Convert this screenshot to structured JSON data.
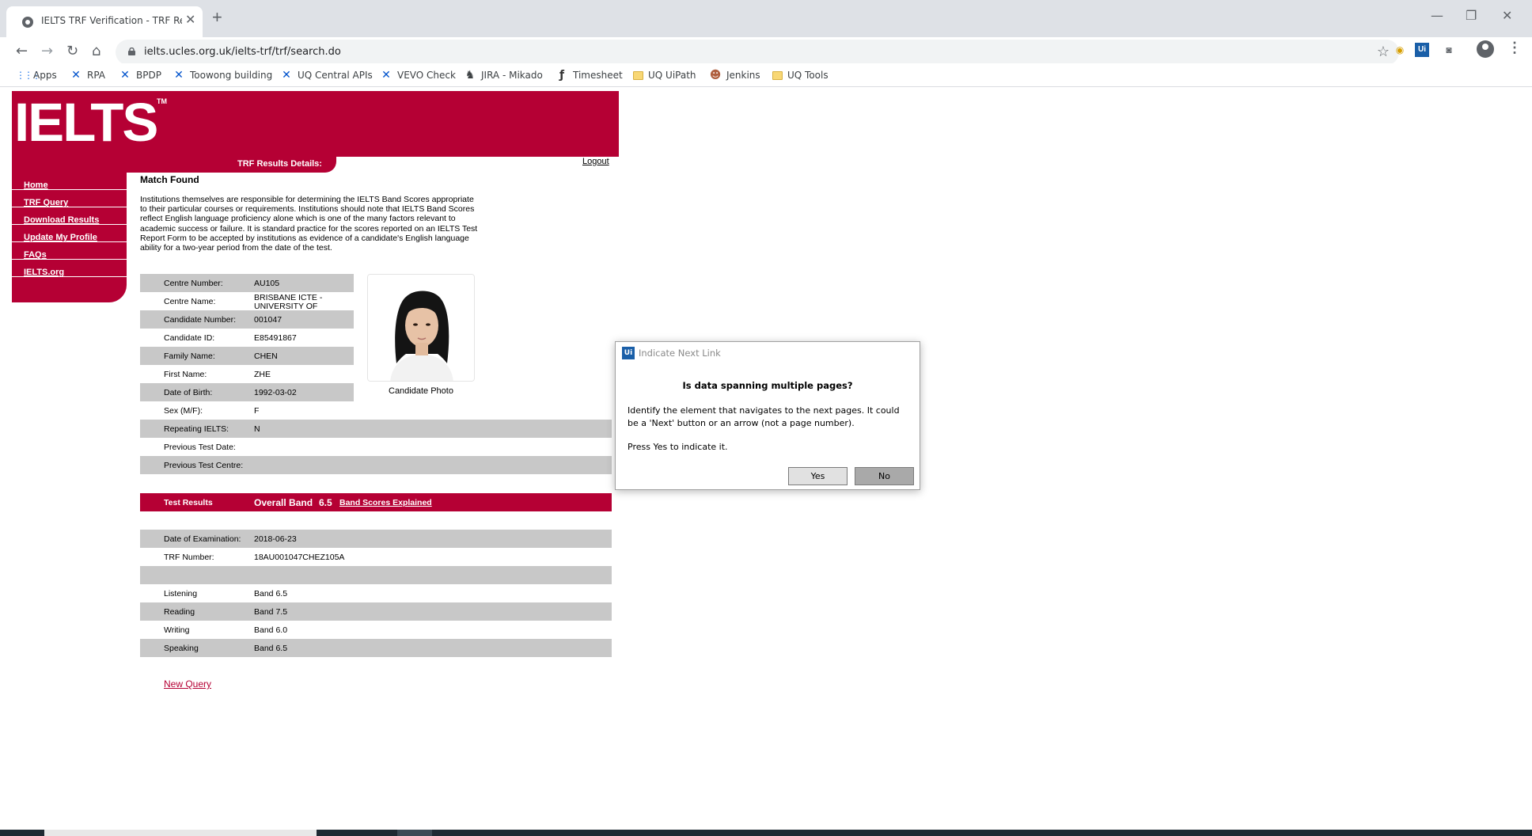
{
  "browser": {
    "tab_title": "IELTS TRF Verification - TRF Resul",
    "tab_close": "✕",
    "new_tab": "+",
    "window_controls": {
      "minimize": "—",
      "restore": "❐",
      "close": "✕"
    },
    "url": "ielts.ucles.org.uk/ielts-trf/trf/search.do",
    "bookmarks": [
      {
        "label": "Apps",
        "icon": "apps-grid-icon"
      },
      {
        "label": "RPA",
        "icon": "jira-icon"
      },
      {
        "label": "BPDP",
        "icon": "jira-icon"
      },
      {
        "label": "Toowong building",
        "icon": "jira-icon"
      },
      {
        "label": "UQ Central APIs",
        "icon": "jira-icon"
      },
      {
        "label": "VEVO Check",
        "icon": "jira-icon"
      },
      {
        "label": "JIRA - Mikado",
        "icon": "person-icon"
      },
      {
        "label": "Timesheet",
        "icon": "timesheet-icon"
      },
      {
        "label": "UQ UiPath",
        "icon": "folder-icon"
      },
      {
        "label": "Jenkins",
        "icon": "jenkins-icon"
      },
      {
        "label": "UQ Tools",
        "icon": "folder-icon"
      }
    ]
  },
  "ielts": {
    "logo": "IELTS",
    "logo_tm": "TM",
    "results_title": "TRF Results Details:",
    "logout": "Logout",
    "sidebar": [
      "Home",
      "TRF Query",
      "Download Results",
      "Update My Profile",
      "FAQs",
      "IELTS.org"
    ],
    "match_found": "Match Found",
    "disclaimer": "Institutions themselves are responsible for determining the IELTS Band Scores appropriate to their particular courses or requirements. Institutions should note that IELTS Band Scores reflect English language proficiency alone which is one of the many factors relevant to academic success or failure. It is standard practice for the scores reported on an IELTS Test Report Form to be accepted by institutions as evidence of a candidate's English language ability for a two-year period from the date of the test.",
    "candidate_rows": [
      {
        "label": "Centre Number:",
        "value": "AU105"
      },
      {
        "label": "Centre Name:",
        "value": "BRISBANE ICTE - UNIVERSITY OF"
      },
      {
        "label": "Candidate Number:",
        "value": "001047"
      },
      {
        "label": "Candidate ID:",
        "value": "E85491867"
      },
      {
        "label": "Family Name:",
        "value": "CHEN"
      },
      {
        "label": "First Name:",
        "value": "ZHE"
      },
      {
        "label": "Date of Birth:",
        "value": "1992-03-02"
      },
      {
        "label": "Sex (M/F):",
        "value": "F"
      },
      {
        "label": "Repeating IELTS:",
        "value": "N"
      },
      {
        "label": "Previous Test Date:",
        "value": ""
      },
      {
        "label": "Previous Test Centre:",
        "value": ""
      }
    ],
    "photo_caption": "Candidate Photo",
    "test_results": {
      "label": "Test Results",
      "overall_label": "Overall Band",
      "overall_value": "6.5",
      "band_link": "Band Scores Explained"
    },
    "exam_rows": [
      {
        "label": "Date of Examination:",
        "value": "2018-06-23"
      },
      {
        "label": "TRF Number:",
        "value": "18AU001047CHEZ105A"
      }
    ],
    "scores": [
      {
        "label": "Listening",
        "value": "Band  6.5"
      },
      {
        "label": "Reading",
        "value": "Band  7.5"
      },
      {
        "label": "Writing",
        "value": "Band  6.0"
      },
      {
        "label": "Speaking",
        "value": "Band  6.5"
      }
    ],
    "new_query": "New Query"
  },
  "dialog": {
    "logo": "Ui",
    "title": "Indicate Next Link",
    "question": "Is data spanning multiple pages?",
    "body": "Identify the element that navigates to the next pages. It could be a 'Next' button or an arrow (not a page number).",
    "press": "Press Yes to indicate it.",
    "yes": "Yes",
    "no": "No"
  },
  "colors": {
    "ielts_red": "#b50034",
    "row_shade": "#c8c8c8"
  }
}
